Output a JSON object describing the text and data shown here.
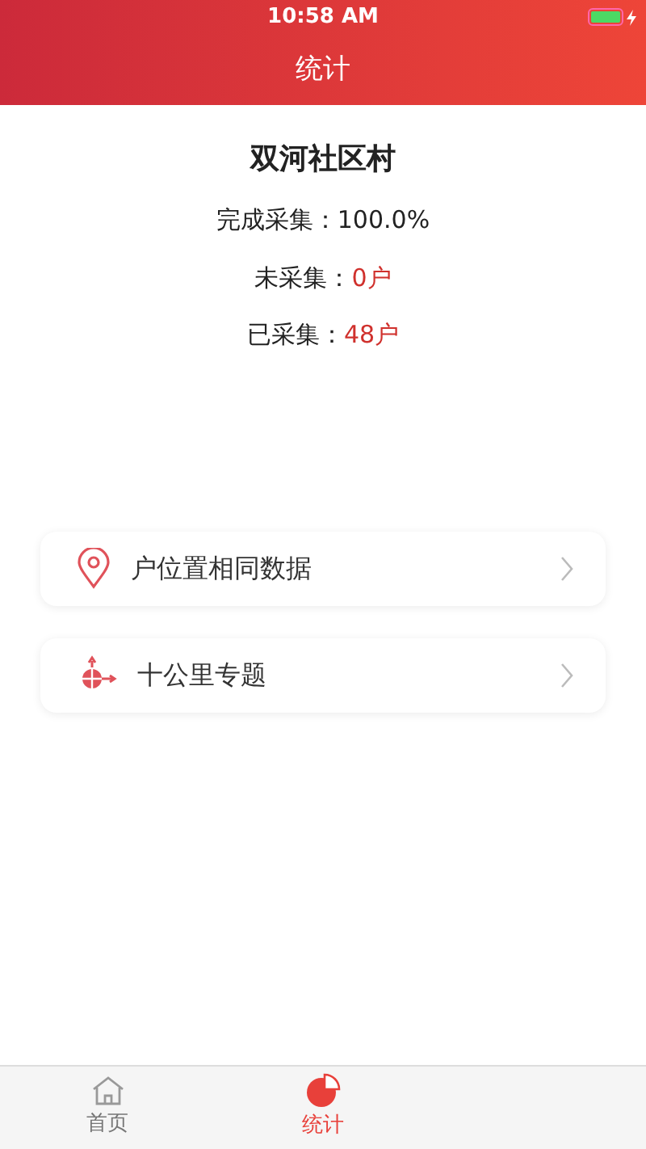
{
  "status_bar": {
    "time": "10:58 AM"
  },
  "header": {
    "title": "统计"
  },
  "village": "双河社区村",
  "stats": [
    {
      "label": "完成采集：",
      "value": "100.0%",
      "color": "#222222"
    },
    {
      "label": "未采集：",
      "value": "0户",
      "color": "#d0312d"
    },
    {
      "label": "已采集：",
      "value": "48户",
      "color": "#d0312d"
    }
  ],
  "menu": [
    {
      "kind": "location",
      "label": "户位置相同数据"
    },
    {
      "kind": "target",
      "label": "十公里专题"
    }
  ],
  "tabs": [
    {
      "kind": "home",
      "label": "首页",
      "selected": false
    },
    {
      "kind": "chart",
      "label": "统计",
      "selected": true
    }
  ]
}
